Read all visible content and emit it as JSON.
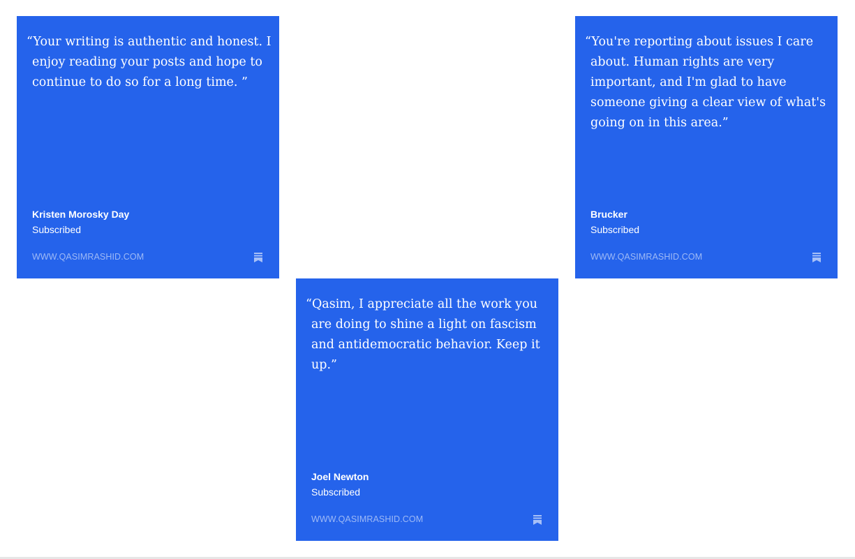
{
  "cards": [
    {
      "quote": "“Your writing is authentic and honest. I enjoy reading your posts and hope to continue to do so for a long time. ”",
      "author": "Kristen Morosky Day",
      "status": "Subscribed",
      "site": "WWW.QASIMRASHID.COM",
      "icon": "substack-bookmark-icon"
    },
    {
      "quote": "“You're reporting about issues I care about. Human rights are very important, and I'm glad to have someone giving a clear view of what's going on in this area.”",
      "author": "Brucker",
      "status": "Subscribed",
      "site": "WWW.QASIMRASHID.COM",
      "icon": "substack-bookmark-icon"
    },
    {
      "quote": "“Qasim, I appreciate all the work you are doing to shine a light on fascism and antidemocratic behavior. Keep it up.”",
      "author": "Joel Newton",
      "status": "Subscribed",
      "site": "WWW.QASIMRASHID.COM",
      "icon": "substack-bookmark-icon"
    }
  ],
  "colors": {
    "card_background": "#2563EB",
    "text": "#FFFFFF"
  }
}
